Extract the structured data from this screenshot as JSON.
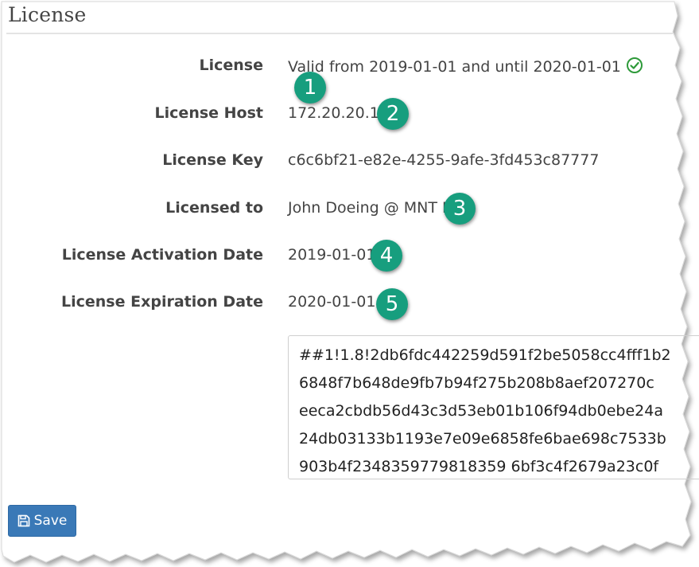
{
  "panel": {
    "title": "License"
  },
  "fields": [
    {
      "label": "License",
      "value": "Valid from 2019-01-01 and until 2020-01-01",
      "status_icon": "check-circle-icon"
    },
    {
      "label": "License Host",
      "value": "172.20.20.1"
    },
    {
      "label": "License Key",
      "value": "c6c6bf21-e82e-4255-9afe-3fd453c87777"
    },
    {
      "label": "Licensed to",
      "value": "John Doeing @ MNT Ltd"
    },
    {
      "label": "License Activation Date",
      "value": "2019-01-01"
    },
    {
      "label": "License Expiration Date",
      "value": "2020-01-01"
    }
  ],
  "license_text": {
    "lines": [
      "##1!1.8!2db6fdc442259d591f2be5058cc4fff1b2",
      "6848f7b648de9fb7b94f275b208b8aef207270c",
      "eeca2cbdb56d43c3d53eb01b106f94db0ebe24a",
      "24db03133b1193e7e09e6858fe6bae698c7533b",
      "903b4f2348359779818359 6bf3c4f2679a23c0f"
    ]
  },
  "annotations": [
    "1",
    "2",
    "3",
    "4",
    "5"
  ],
  "buttons": {
    "save_label": "Save",
    "save_icon": "floppy-disk-icon"
  },
  "colors": {
    "badge": "#179e7e",
    "save_button": "#3a79b7",
    "check": "#2e9a3a"
  }
}
